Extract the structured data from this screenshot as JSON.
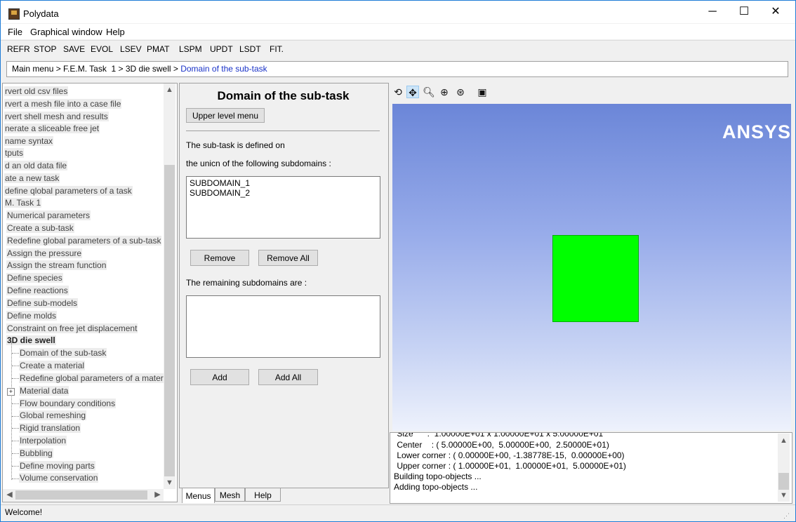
{
  "window": {
    "title": "Polydata",
    "minimize": "─",
    "maximize": "☐",
    "close": "✕"
  },
  "menubar": {
    "items": [
      "File",
      "Graphical window",
      "Help"
    ]
  },
  "toolbar": {
    "items": [
      "REFR",
      "STOP",
      "SAVE",
      "EVOL",
      "LSEV",
      "PMAT",
      "LSPM",
      "UPDT",
      "LSDT",
      "FIT."
    ]
  },
  "breadcrumb": {
    "path": "Main menu > F.E.M. Task  1 > 3D die swell > ",
    "current": "Domain of the sub-task"
  },
  "tree": {
    "items": [
      "rvert old csv files",
      "rvert a mesh file into a case file",
      "rvert shell mesh and results",
      "nerate a sliceable free jet",
      "name syntax",
      "tputs",
      "d an old data file",
      "ate a new task",
      "define qlobal parameters of a task",
      "M. Task  1",
      "Numerical parameters",
      "Create a sub-task",
      "Redefine global parameters of a sub-task",
      "Assign the pressure",
      "Assign the stream function",
      "Define species",
      "Define reactions",
      "Define sub-models",
      "Define molds",
      "Constraint on free jet displacement",
      "3D die swell",
      "Domain of the sub-task",
      "Create a material",
      "Redefine global parameters of a materia",
      "Material data",
      "Flow boundary conditions",
      "Global remeshing",
      "Rigid translation",
      "Interpolation",
      "Bubbling",
      "Define moving parts",
      "Volume conservation"
    ]
  },
  "panel": {
    "title": "Domain of the sub-task",
    "upper_button": "Upper level menu",
    "defined_text": "The sub-task is defined on",
    "union_text": "the unicn of the following subdomains :",
    "subdomains": [
      "SUBDOMAIN_1",
      "SUBDOMAIN_2"
    ],
    "remove": "Remove",
    "remove_all": "Remove All",
    "remaining_text": "The remaining subdomains are :",
    "remaining": [],
    "add": "Add",
    "add_all": "Add All"
  },
  "tabs": [
    "Menus",
    "Mesh",
    "Help"
  ],
  "graphics": {
    "logo": "ANSYS",
    "shape_color": "#00ff00",
    "icons": [
      "rotate-icon",
      "pan-icon",
      "zoom-region-icon",
      "zoom-in-icon",
      "zoom-fit-icon",
      "camera-icon"
    ]
  },
  "console": {
    "lines": [
      " Size      :  1.00000E+01 x 1.00000E+01 x 5.00000E+01",
      " Center    : ( 5.00000E+00,  5.00000E+00,  2.50000E+01)",
      " Lower corner : ( 0.00000E+00, -1.38778E-15,  0.00000E+00)",
      " Upper corner : ( 1.00000E+01,  1.00000E+01,  5.00000E+01)",
      "Building topo-objects ...",
      "Adding topo-objects ..."
    ]
  },
  "status": {
    "text": "Welcome!"
  }
}
